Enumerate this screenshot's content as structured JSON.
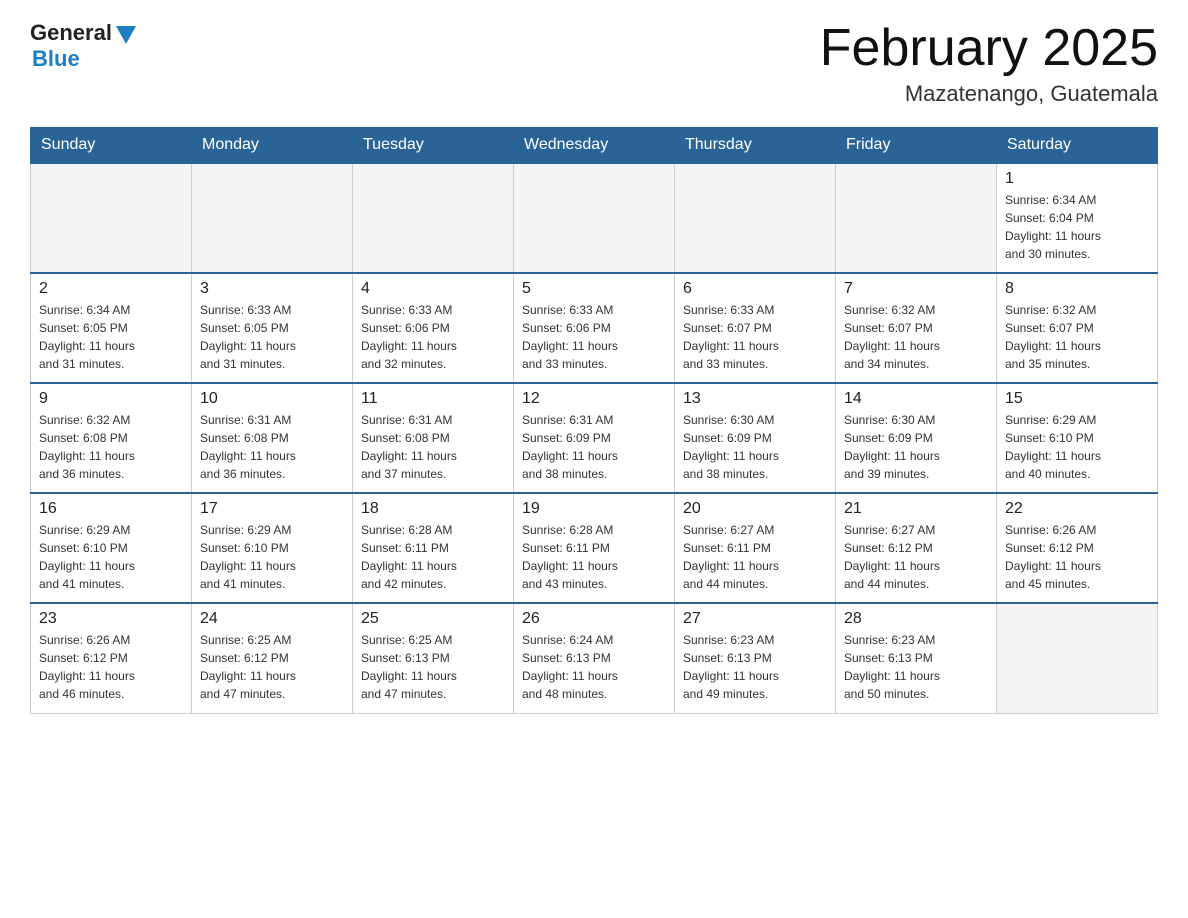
{
  "header": {
    "logo_general": "General",
    "logo_blue": "Blue",
    "title": "February 2025",
    "subtitle": "Mazatenango, Guatemala"
  },
  "days_of_week": [
    "Sunday",
    "Monday",
    "Tuesday",
    "Wednesday",
    "Thursday",
    "Friday",
    "Saturday"
  ],
  "weeks": [
    [
      {
        "day": "",
        "info": ""
      },
      {
        "day": "",
        "info": ""
      },
      {
        "day": "",
        "info": ""
      },
      {
        "day": "",
        "info": ""
      },
      {
        "day": "",
        "info": ""
      },
      {
        "day": "",
        "info": ""
      },
      {
        "day": "1",
        "info": "Sunrise: 6:34 AM\nSunset: 6:04 PM\nDaylight: 11 hours\nand 30 minutes."
      }
    ],
    [
      {
        "day": "2",
        "info": "Sunrise: 6:34 AM\nSunset: 6:05 PM\nDaylight: 11 hours\nand 31 minutes."
      },
      {
        "day": "3",
        "info": "Sunrise: 6:33 AM\nSunset: 6:05 PM\nDaylight: 11 hours\nand 31 minutes."
      },
      {
        "day": "4",
        "info": "Sunrise: 6:33 AM\nSunset: 6:06 PM\nDaylight: 11 hours\nand 32 minutes."
      },
      {
        "day": "5",
        "info": "Sunrise: 6:33 AM\nSunset: 6:06 PM\nDaylight: 11 hours\nand 33 minutes."
      },
      {
        "day": "6",
        "info": "Sunrise: 6:33 AM\nSunset: 6:07 PM\nDaylight: 11 hours\nand 33 minutes."
      },
      {
        "day": "7",
        "info": "Sunrise: 6:32 AM\nSunset: 6:07 PM\nDaylight: 11 hours\nand 34 minutes."
      },
      {
        "day": "8",
        "info": "Sunrise: 6:32 AM\nSunset: 6:07 PM\nDaylight: 11 hours\nand 35 minutes."
      }
    ],
    [
      {
        "day": "9",
        "info": "Sunrise: 6:32 AM\nSunset: 6:08 PM\nDaylight: 11 hours\nand 36 minutes."
      },
      {
        "day": "10",
        "info": "Sunrise: 6:31 AM\nSunset: 6:08 PM\nDaylight: 11 hours\nand 36 minutes."
      },
      {
        "day": "11",
        "info": "Sunrise: 6:31 AM\nSunset: 6:08 PM\nDaylight: 11 hours\nand 37 minutes."
      },
      {
        "day": "12",
        "info": "Sunrise: 6:31 AM\nSunset: 6:09 PM\nDaylight: 11 hours\nand 38 minutes."
      },
      {
        "day": "13",
        "info": "Sunrise: 6:30 AM\nSunset: 6:09 PM\nDaylight: 11 hours\nand 38 minutes."
      },
      {
        "day": "14",
        "info": "Sunrise: 6:30 AM\nSunset: 6:09 PM\nDaylight: 11 hours\nand 39 minutes."
      },
      {
        "day": "15",
        "info": "Sunrise: 6:29 AM\nSunset: 6:10 PM\nDaylight: 11 hours\nand 40 minutes."
      }
    ],
    [
      {
        "day": "16",
        "info": "Sunrise: 6:29 AM\nSunset: 6:10 PM\nDaylight: 11 hours\nand 41 minutes."
      },
      {
        "day": "17",
        "info": "Sunrise: 6:29 AM\nSunset: 6:10 PM\nDaylight: 11 hours\nand 41 minutes."
      },
      {
        "day": "18",
        "info": "Sunrise: 6:28 AM\nSunset: 6:11 PM\nDaylight: 11 hours\nand 42 minutes."
      },
      {
        "day": "19",
        "info": "Sunrise: 6:28 AM\nSunset: 6:11 PM\nDaylight: 11 hours\nand 43 minutes."
      },
      {
        "day": "20",
        "info": "Sunrise: 6:27 AM\nSunset: 6:11 PM\nDaylight: 11 hours\nand 44 minutes."
      },
      {
        "day": "21",
        "info": "Sunrise: 6:27 AM\nSunset: 6:12 PM\nDaylight: 11 hours\nand 44 minutes."
      },
      {
        "day": "22",
        "info": "Sunrise: 6:26 AM\nSunset: 6:12 PM\nDaylight: 11 hours\nand 45 minutes."
      }
    ],
    [
      {
        "day": "23",
        "info": "Sunrise: 6:26 AM\nSunset: 6:12 PM\nDaylight: 11 hours\nand 46 minutes."
      },
      {
        "day": "24",
        "info": "Sunrise: 6:25 AM\nSunset: 6:12 PM\nDaylight: 11 hours\nand 47 minutes."
      },
      {
        "day": "25",
        "info": "Sunrise: 6:25 AM\nSunset: 6:13 PM\nDaylight: 11 hours\nand 47 minutes."
      },
      {
        "day": "26",
        "info": "Sunrise: 6:24 AM\nSunset: 6:13 PM\nDaylight: 11 hours\nand 48 minutes."
      },
      {
        "day": "27",
        "info": "Sunrise: 6:23 AM\nSunset: 6:13 PM\nDaylight: 11 hours\nand 49 minutes."
      },
      {
        "day": "28",
        "info": "Sunrise: 6:23 AM\nSunset: 6:13 PM\nDaylight: 11 hours\nand 50 minutes."
      },
      {
        "day": "",
        "info": ""
      }
    ]
  ]
}
